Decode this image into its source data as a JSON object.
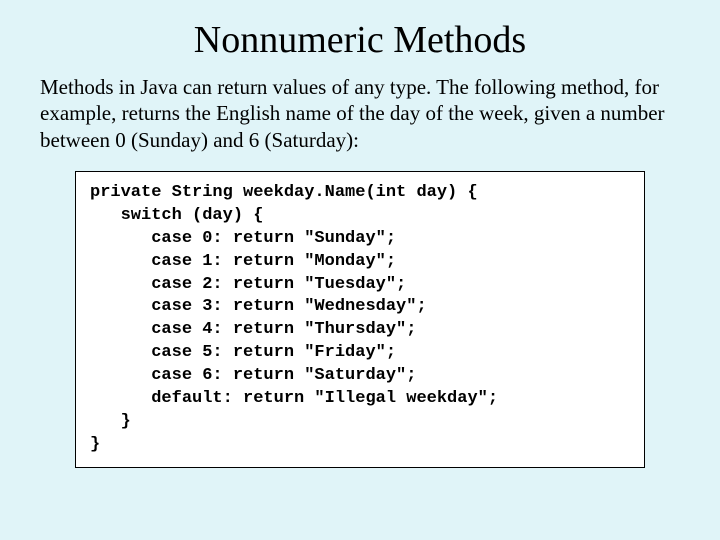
{
  "title": "Nonnumeric Methods",
  "paragraph": "Methods in Java can return values of any type.  The following method, for example, returns the English name of the day of the week, given a number between 0 (Sunday) and 6 (Saturday):",
  "code": "private String weekday.Name(int day) {\n   switch (day) {\n      case 0: return \"Sunday\";\n      case 1: return \"Monday\";\n      case 2: return \"Tuesday\";\n      case 3: return \"Wednesday\";\n      case 4: return \"Thursday\";\n      case 5: return \"Friday\";\n      case 6: return \"Saturday\";\n      default: return \"Illegal weekday\";\n   }\n}"
}
